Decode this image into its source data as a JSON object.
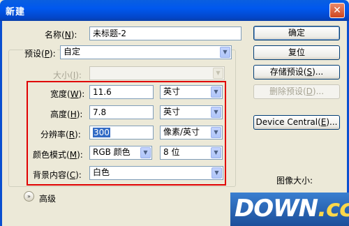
{
  "window": {
    "title": "新建",
    "close_glyph": "✕"
  },
  "name_field": {
    "label": "名称",
    "hotkey": "N",
    "value": "未标题-2"
  },
  "preset": {
    "label": "预设",
    "hotkey": "P",
    "value": "自定"
  },
  "size": {
    "label": "大小",
    "hotkey": "I",
    "value": ""
  },
  "width": {
    "label": "宽度",
    "hotkey": "W",
    "value": "11.6",
    "unit": "英寸"
  },
  "height": {
    "label": "高度",
    "hotkey": "H",
    "value": "7.8",
    "unit": "英寸"
  },
  "resolution": {
    "label": "分辨率",
    "hotkey": "R",
    "value": "300",
    "unit": "像素/英寸"
  },
  "color_mode": {
    "label": "颜色模式",
    "hotkey": "M",
    "value": "RGB 颜色",
    "depth": "8 位"
  },
  "background": {
    "label": "背景内容",
    "hotkey": "C",
    "value": "白色"
  },
  "advanced": {
    "label": "高级",
    "icon": "chevron-double-down-icon"
  },
  "buttons": {
    "ok": "确定",
    "reset": "复位",
    "save_preset": "存储预设(",
    "save_preset_key": "S",
    "save_preset_tail": ")...",
    "delete_preset": "删除预设(",
    "delete_preset_key": "D",
    "delete_preset_tail": ")...",
    "device_central": "Device Central(",
    "device_central_key": "E",
    "device_central_tail": ")..."
  },
  "image_size": {
    "label": "图像大小:"
  },
  "watermark": {
    "main": "DOWN",
    "suffix": ".cc"
  },
  "colors": {
    "highlight": "#e00000",
    "title_bar": "#0058ee",
    "selection": "#316ac5"
  }
}
